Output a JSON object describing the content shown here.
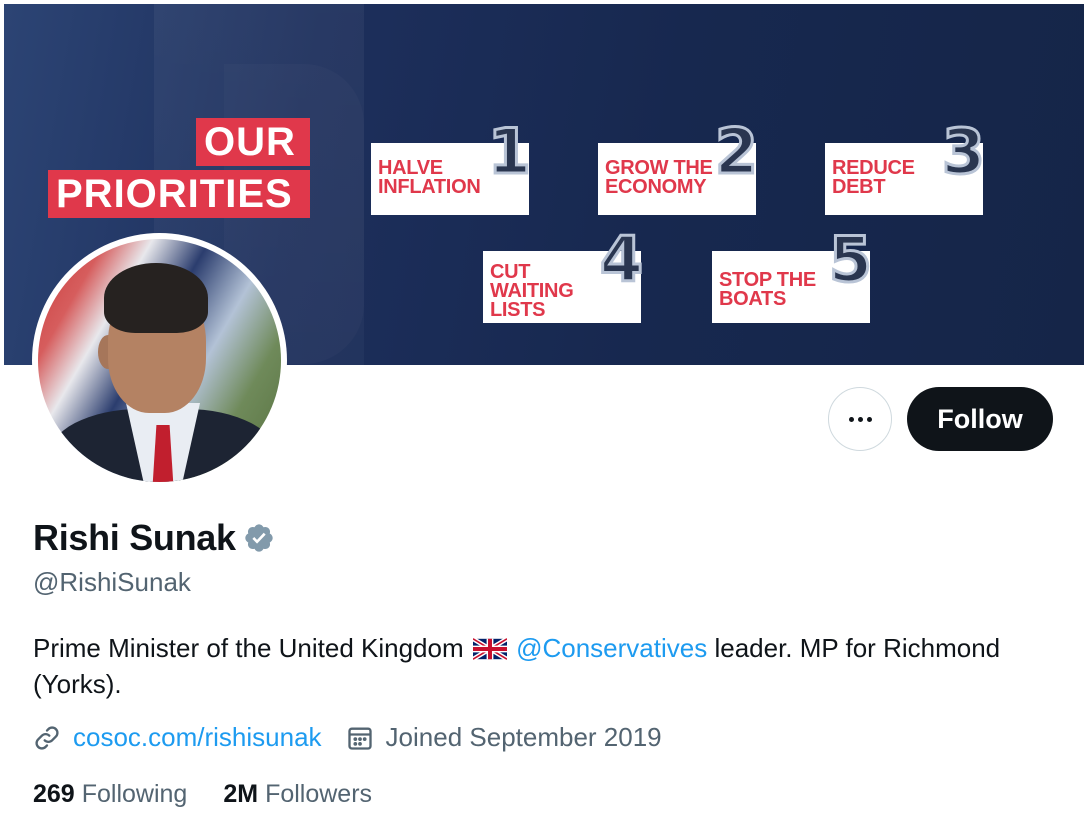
{
  "banner": {
    "headline_line1": "OUR",
    "headline_line2": "PRIORITIES",
    "priorities": [
      {
        "number": "1",
        "text": "HALVE INFLATION"
      },
      {
        "number": "2",
        "text": "GROW THE ECONOMY"
      },
      {
        "number": "3",
        "text": "REDUCE DEBT"
      },
      {
        "number": "4",
        "text": "CUT WAITING LISTS"
      },
      {
        "number": "5",
        "text": "STOP THE BOATS"
      }
    ],
    "colors": {
      "background": "#17284f",
      "accent_red": "#e0384b"
    }
  },
  "profile": {
    "display_name": "Rishi Sunak",
    "handle": "@RishiSunak",
    "verified_icon": "verified-badge-icon",
    "bio_before": "Prime Minister of the United Kingdom",
    "bio_flag_icon": "uk-flag-icon",
    "bio_mention": "@Conservatives",
    "bio_after": " leader. MP for Richmond (Yorks).",
    "website": "cosoc.com/rishisunak",
    "joined": "Joined September 2019",
    "following_count": "269",
    "following_label": "Following",
    "followers_count": "2M",
    "followers_label": "Followers"
  },
  "actions": {
    "more_icon": "more-dots-icon",
    "follow_label": "Follow"
  },
  "colors": {
    "link_blue": "#1d9bf0",
    "secondary_text": "#536471",
    "primary_text": "#0f1419"
  }
}
